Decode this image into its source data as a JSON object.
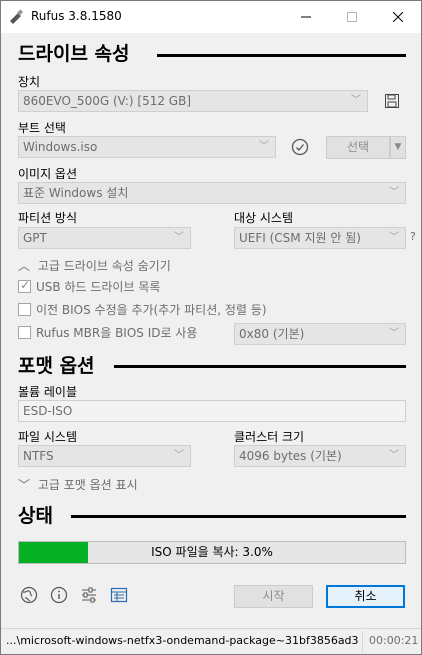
{
  "window": {
    "title": "Rufus 3.8.1580"
  },
  "drive_section": {
    "heading": "드라이브 속성",
    "device_label": "장치",
    "device_value": "860EVO_500G (V:) [512 GB]",
    "boot_label": "부트 선택",
    "boot_value": "Windows.iso",
    "select_button": "선택",
    "image_option_label": "이미지 옵션",
    "image_option_value": "표준 Windows 설치",
    "partition_label": "파티션 방식",
    "partition_value": "GPT",
    "target_label": "대상 시스템",
    "target_value": "UEFI (CSM 지원 안 됨)",
    "target_help": "?",
    "advanced_toggle": "고급 드라이브 속성 숨기기",
    "usb_hdd_label": "USB 하드 드라이브 목록",
    "usb_hdd_checked": true,
    "bios_fix_label": "이전 BIOS 수정을 추가(추가 파티션, 정렬 등)",
    "bios_fix_checked": false,
    "rufus_mbr_label": "Rufus MBR을 BIOS ID로 사용",
    "rufus_mbr_checked": false,
    "bios_id_value": "0x80 (기본)"
  },
  "format_section": {
    "heading": "포맷 옵션",
    "volume_label_label": "볼륨 레이블",
    "volume_label_value": "ESD-ISO",
    "filesystem_label": "파일 시스템",
    "filesystem_value": "NTFS",
    "cluster_label": "클러스터 크기",
    "cluster_value": "4096 bytes (기본)",
    "advanced_toggle": "고급 포맷 옵션 표시"
  },
  "status_section": {
    "heading": "상태",
    "progress_text": "ISO 파일을 복사: 3.0%",
    "progress_fraction": 0.18
  },
  "actions": {
    "start_button": "시작",
    "cancel_button": "취소"
  },
  "statusbar": {
    "path": "...\\microsoft-windows-netfx3-ondemand-package~31bf3856ad3...",
    "elapsed": "00:00:21"
  },
  "icons": [
    "globe-icon",
    "info-icon",
    "settings-sliders-icon",
    "log-icon",
    "save-icon",
    "checkmark-circle-icon",
    "usb-icon"
  ]
}
